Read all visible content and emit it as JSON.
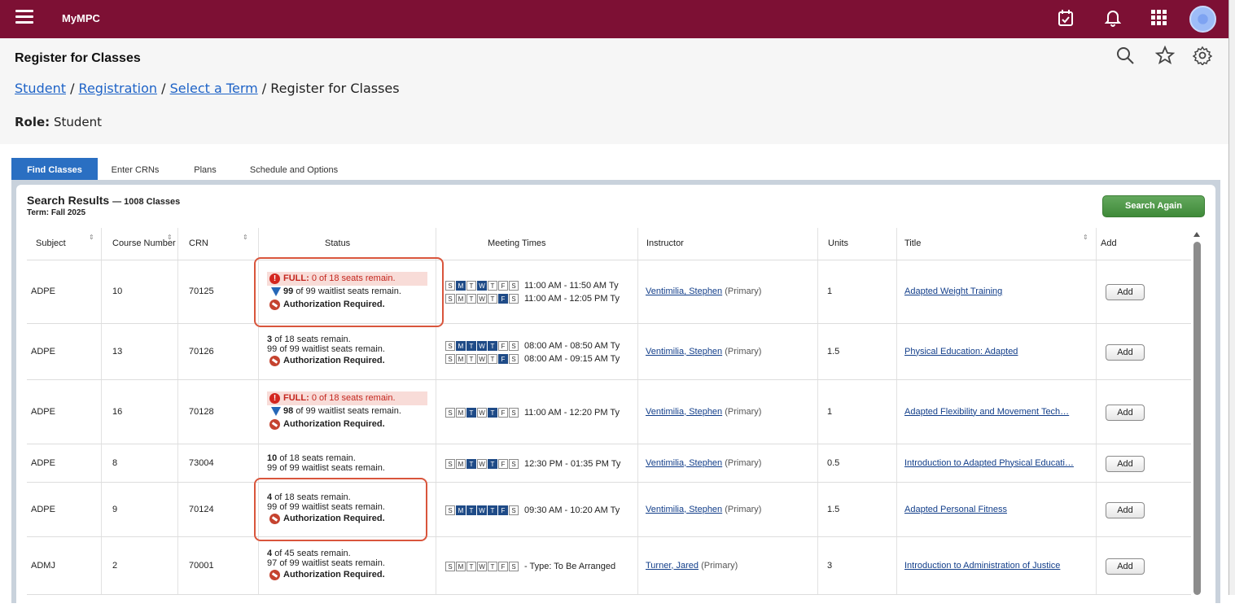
{
  "app": {
    "brand": "MyMPC"
  },
  "topbar_icons": [
    "calendar-check-icon",
    "bell-icon",
    "grid-icon",
    "avatar"
  ],
  "page": {
    "title": "Register for Classes",
    "breadcrumb": [
      {
        "label": "Student",
        "link": true
      },
      {
        "label": "Registration",
        "link": true
      },
      {
        "label": "Select a Term",
        "link": true
      },
      {
        "label": "Register for Classes",
        "link": false
      }
    ],
    "separator": " / ",
    "role_label": "Role:",
    "role_value": "Student"
  },
  "tabs": [
    {
      "label": "Find Classes",
      "active": true
    },
    {
      "label": "Enter CRNs",
      "active": false
    },
    {
      "label": "Plans",
      "active": false
    },
    {
      "label": "Schedule and Options",
      "active": false
    }
  ],
  "results": {
    "title": "Search Results",
    "count": "— 1008 Classes",
    "term": "Term: Fall 2025",
    "search_again": "Search Again"
  },
  "columns": {
    "subject": "Subject",
    "course_number": "Course Number",
    "crn": "CRN",
    "status": "Status",
    "meeting_times": "Meeting Times",
    "instructor": "Instructor",
    "units": "Units",
    "title": "Title",
    "add": "Add"
  },
  "day_letters": [
    "S",
    "M",
    "T",
    "W",
    "T",
    "F",
    "S"
  ],
  "rows": [
    {
      "subject": "ADPE",
      "course_number": "10",
      "crn": "70125",
      "full": true,
      "full_prefix": "FULL:",
      "seats": "0 of 18 seats remain.",
      "waitlist_num": "99",
      "waitlist_text": "of 99 waitlist seats remain.",
      "waitlist_icon": true,
      "auth": "Authorization Required.",
      "meetings": [
        {
          "days": [
            false,
            true,
            false,
            true,
            false,
            false,
            false
          ],
          "time": "11:00 AM - 11:50 AM Ty"
        },
        {
          "days": [
            false,
            false,
            false,
            false,
            false,
            true,
            false
          ],
          "time": "11:00 AM - 12:05 PM Ty"
        }
      ],
      "instructor": "Ventimilia, Stephen",
      "instructor_role": "(Primary)",
      "units": "1",
      "title": "Adapted Weight Training",
      "add": "Add"
    },
    {
      "subject": "ADPE",
      "course_number": "13",
      "crn": "70126",
      "full": false,
      "seats_num": "3",
      "seats": "of 18 seats remain.",
      "waitlist_num": "99",
      "waitlist_text": "of 99 waitlist seats remain.",
      "waitlist_icon": false,
      "auth": "Authorization Required.",
      "meetings": [
        {
          "days": [
            false,
            true,
            true,
            true,
            true,
            false,
            false
          ],
          "time": "08:00 AM - 08:50 AM Ty"
        },
        {
          "days": [
            false,
            false,
            false,
            false,
            false,
            true,
            false
          ],
          "time": "08:00 AM - 09:15 AM Ty"
        }
      ],
      "instructor": "Ventimilia, Stephen",
      "instructor_role": "(Primary)",
      "units": "1.5",
      "title": "Physical Education: Adapted",
      "add": "Add"
    },
    {
      "subject": "ADPE",
      "course_number": "16",
      "crn": "70128",
      "full": true,
      "full_prefix": "FULL:",
      "seats": "0 of 18 seats remain.",
      "waitlist_num": "98",
      "waitlist_text": "of 99 waitlist seats remain.",
      "waitlist_icon": true,
      "auth": "Authorization Required.",
      "meetings": [
        {
          "days": [
            false,
            false,
            true,
            false,
            true,
            false,
            false
          ],
          "time": "11:00 AM - 12:20 PM Ty"
        }
      ],
      "instructor": "Ventimilia, Stephen",
      "instructor_role": "(Primary)",
      "units": "1",
      "title": "Adapted Flexibility and Movement Tech…",
      "add": "Add"
    },
    {
      "subject": "ADPE",
      "course_number": "8",
      "crn": "73004",
      "full": false,
      "seats_num": "10",
      "seats": "of 18 seats remain.",
      "waitlist_num": "99",
      "waitlist_text": "of 99 waitlist seats remain.",
      "waitlist_icon": false,
      "auth": "",
      "meetings": [
        {
          "days": [
            false,
            false,
            true,
            false,
            true,
            false,
            false
          ],
          "time": "12:30 PM - 01:35 PM Ty"
        }
      ],
      "instructor": "Ventimilia, Stephen",
      "instructor_role": "(Primary)",
      "units": "0.5",
      "title": "Introduction to Adapted Physical Educati…",
      "add": "Add"
    },
    {
      "subject": "ADPE",
      "course_number": "9",
      "crn": "70124",
      "full": false,
      "seats_num": "4",
      "seats": "of 18 seats remain.",
      "waitlist_num": "99",
      "waitlist_text": "of 99 waitlist seats remain.",
      "waitlist_icon": false,
      "auth": "Authorization Required.",
      "meetings": [
        {
          "days": [
            false,
            true,
            true,
            true,
            true,
            true,
            false
          ],
          "time": "09:30 AM - 10:20 AM Ty"
        }
      ],
      "instructor": "Ventimilia, Stephen",
      "instructor_role": "(Primary)",
      "units": "1.5",
      "title": "Adapted Personal Fitness",
      "add": "Add"
    },
    {
      "subject": "ADMJ",
      "course_number": "2",
      "crn": "70001",
      "full": false,
      "seats_num": "4",
      "seats": "of 45 seats remain.",
      "waitlist_num": "97",
      "waitlist_text": "of 99 waitlist seats remain.",
      "waitlist_icon": false,
      "auth": "Authorization Required.",
      "meetings": [
        {
          "days": [
            false,
            false,
            false,
            false,
            false,
            false,
            false
          ],
          "time": "- Type: To Be Arranged",
          "tba": true
        }
      ],
      "instructor": "Turner, Jared",
      "instructor_role": "(Primary)",
      "units": "3",
      "title": "Introduction to Administration of Justice",
      "add": "Add"
    }
  ],
  "colors": {
    "topbar": "#7d1034",
    "active_tab": "#2a6fc2",
    "day_on": "#1f4b87",
    "highlight": "#d9553c",
    "full_bg": "#f8dcd8",
    "full_text": "#c4261e",
    "search_again": "#4f9a49"
  }
}
